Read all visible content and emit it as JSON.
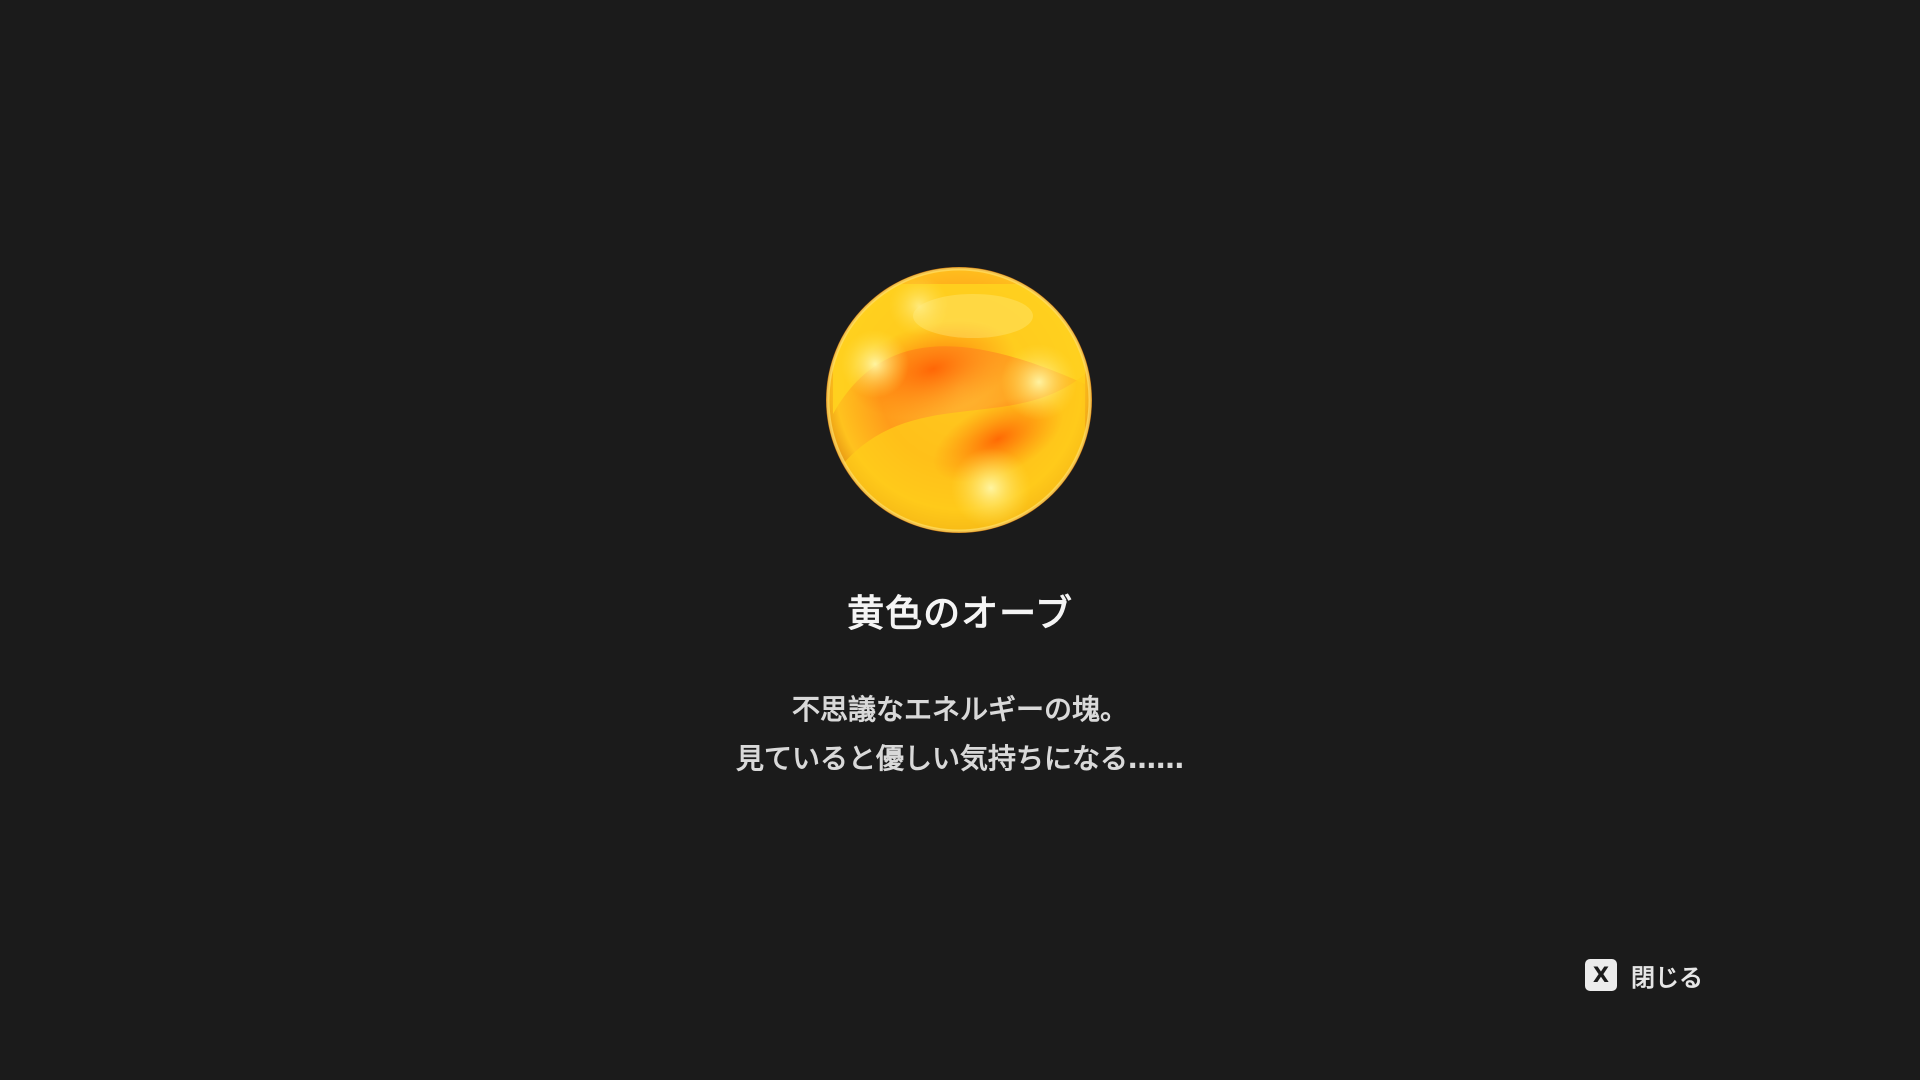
{
  "item": {
    "name": "黄色のオーブ",
    "icon": "yellow-orb-icon",
    "description_lines": [
      "不思議なエネルギーの塊。",
      "見ていると優しい気持ちになる……"
    ]
  },
  "prompt": {
    "key": "X",
    "close_label": "閉じる"
  },
  "colors": {
    "background": "#1b1b1b",
    "orb_core": "#ffd21f",
    "orb_swirl": "#ff7a0a",
    "text": "#f4f4f4"
  }
}
